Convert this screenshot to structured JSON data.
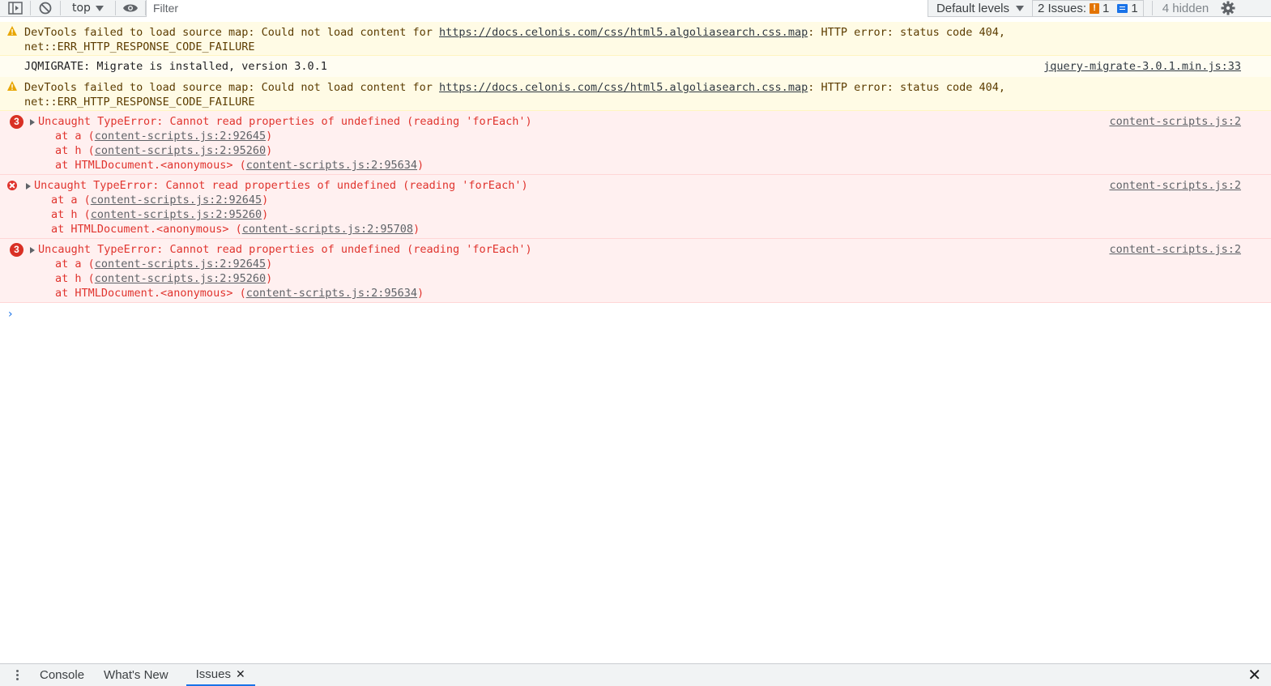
{
  "toolbar": {
    "context": "top",
    "filter_placeholder": "Filter",
    "levels_label": "Default levels",
    "issues_label": "2 Issues:",
    "issues_warn_count": "1",
    "issues_info_count": "1",
    "hidden_label": "4 hidden"
  },
  "messages": [
    {
      "level": "warning",
      "line1_prefix": "DevTools failed to load source map: Could not load content for ",
      "url": "https://docs.celonis.com/css/html5.algoliasearch.css.map",
      "line1_suffix": ": HTTP error: status code 404,",
      "line2": "net::ERR_HTTP_RESPONSE_CODE_FAILURE"
    },
    {
      "level": "info",
      "text": "JQMIGRATE: Migrate is installed, version 3.0.1",
      "source": "jquery-migrate-3.0.1.min.js:33"
    },
    {
      "level": "warning",
      "line1_prefix": "DevTools failed to load source map: Could not load content for ",
      "url": "https://docs.celonis.com/css/html5.algoliasearch.css.map",
      "line1_suffix": ": HTTP error: status code 404,",
      "line2": "net::ERR_HTTP_RESPONSE_CODE_FAILURE"
    },
    {
      "level": "error",
      "count": "3",
      "text": "Uncaught TypeError: Cannot read properties of undefined (reading 'forEach')",
      "source": "content-scripts.js:2",
      "stack": [
        {
          "prefix": "at a (",
          "loc": "content-scripts.js:2:92645",
          "suffix": ")"
        },
        {
          "prefix": "at h (",
          "loc": "content-scripts.js:2:95260",
          "suffix": ")"
        },
        {
          "prefix": "at HTMLDocument.<anonymous> (",
          "loc": "content-scripts.js:2:95634",
          "suffix": ")"
        }
      ]
    },
    {
      "level": "error",
      "count": "",
      "text": "Uncaught TypeError: Cannot read properties of undefined (reading 'forEach')",
      "source": "content-scripts.js:2",
      "stack": [
        {
          "prefix": "at a (",
          "loc": "content-scripts.js:2:92645",
          "suffix": ")"
        },
        {
          "prefix": "at h (",
          "loc": "content-scripts.js:2:95260",
          "suffix": ")"
        },
        {
          "prefix": "at HTMLDocument.<anonymous> (",
          "loc": "content-scripts.js:2:95708",
          "suffix": ")"
        }
      ]
    },
    {
      "level": "error",
      "count": "3",
      "text": "Uncaught TypeError: Cannot read properties of undefined (reading 'forEach')",
      "source": "content-scripts.js:2",
      "stack": [
        {
          "prefix": "at a (",
          "loc": "content-scripts.js:2:92645",
          "suffix": ")"
        },
        {
          "prefix": "at h (",
          "loc": "content-scripts.js:2:95260",
          "suffix": ")"
        },
        {
          "prefix": "at HTMLDocument.<anonymous> (",
          "loc": "content-scripts.js:2:95634",
          "suffix": ")"
        }
      ]
    }
  ],
  "drawer": {
    "tabs": [
      "Console",
      "What's New",
      "Issues"
    ]
  }
}
